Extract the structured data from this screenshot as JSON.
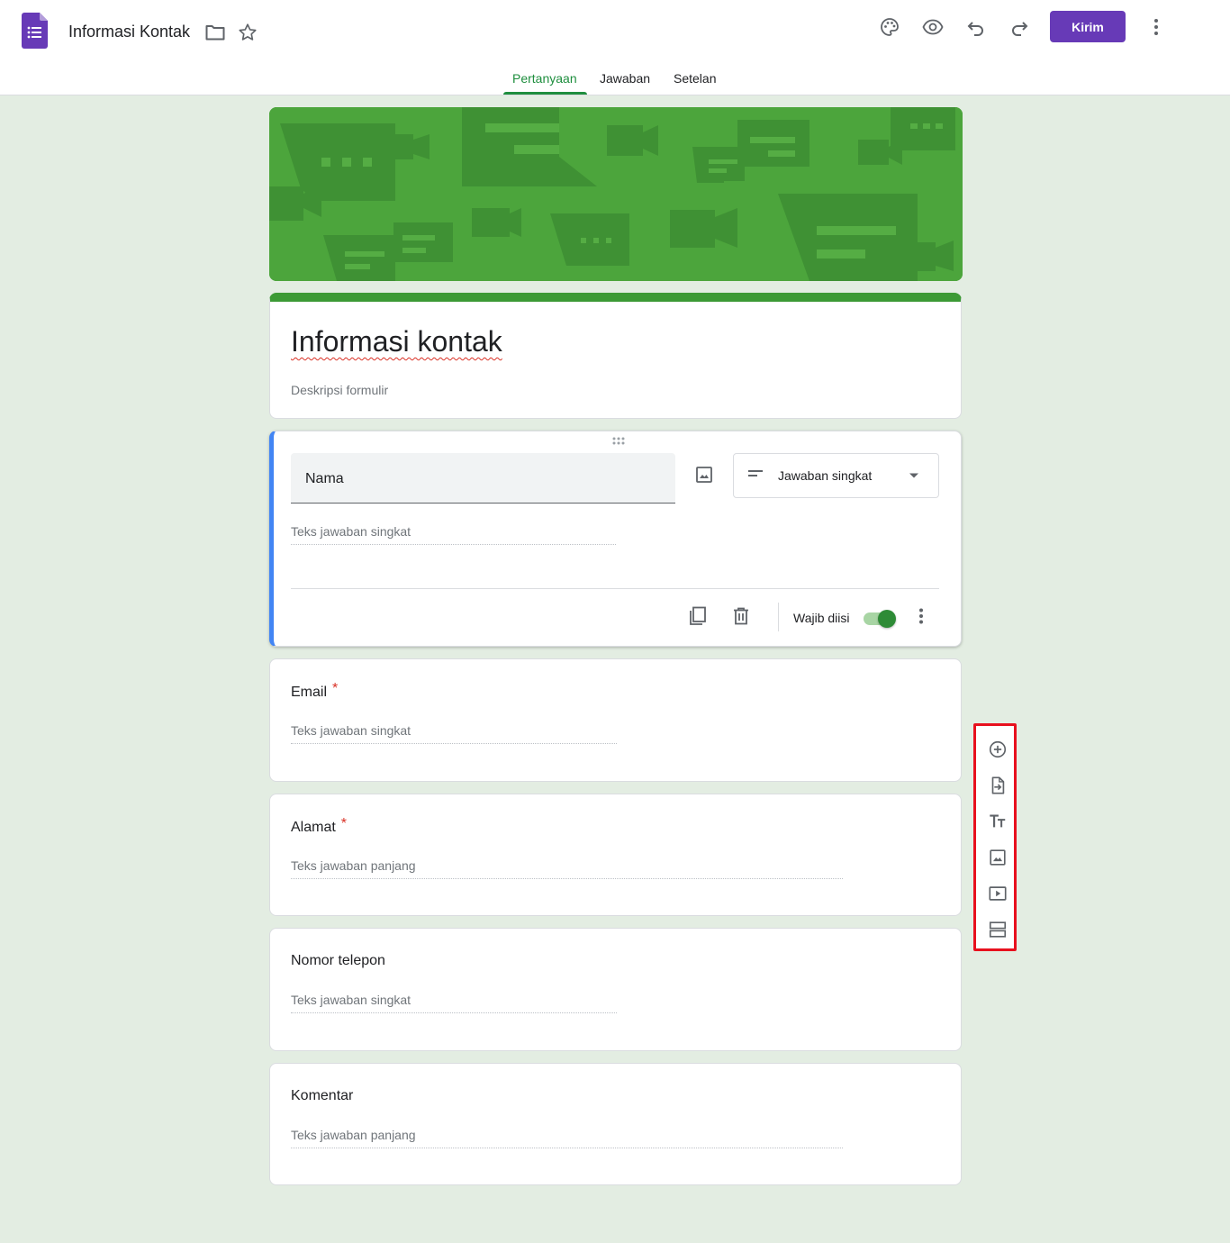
{
  "header": {
    "doc_title": "Informasi Kontak",
    "send_label": "Kirim",
    "accent_color": "#673ab7"
  },
  "tabs": [
    {
      "label": "Pertanyaan",
      "active": true
    },
    {
      "label": "Jawaban",
      "active": false
    },
    {
      "label": "Setelan",
      "active": false
    }
  ],
  "form": {
    "title": "Informasi kontak",
    "description_placeholder": "Deskripsi formulir",
    "theme_color": "#3c9a35"
  },
  "active_question": {
    "title": "Nama",
    "type_label": "Jawaban singkat",
    "answer_placeholder": "Teks jawaban singkat",
    "required_label": "Wajib diisi",
    "required": true
  },
  "questions": [
    {
      "title": "Email",
      "required_mark": "*",
      "answer_placeholder": "Teks jawaban singkat"
    },
    {
      "title": "Alamat",
      "required_mark": "*",
      "answer_placeholder": "Teks jawaban panjang"
    },
    {
      "title": "Nomor telepon",
      "required_mark": "",
      "answer_placeholder": "Teks jawaban singkat"
    },
    {
      "title": "Komentar",
      "required_mark": "",
      "answer_placeholder": "Teks jawaban panjang"
    }
  ],
  "toolbar_icons": [
    "add-question-icon",
    "import-questions-icon",
    "add-title-icon",
    "add-image-icon",
    "add-video-icon",
    "add-section-icon"
  ]
}
